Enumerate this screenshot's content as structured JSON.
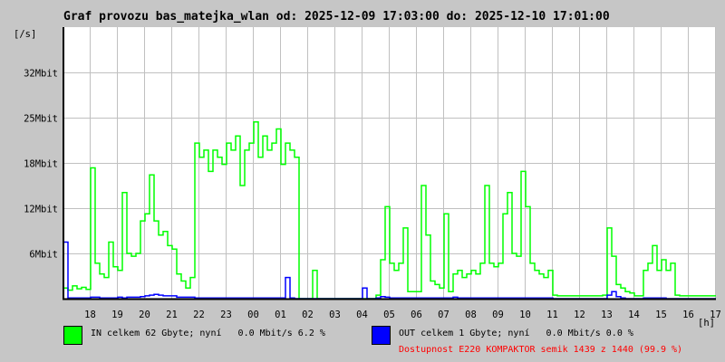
{
  "chart_data": {
    "type": "line",
    "title": "Graf provozu bas_matejka_wlan od: 2025-12-09 17:03:00 do: 2025-12-10 17:01:00",
    "ylabel": "[/s]",
    "xlabel": "[h]",
    "start_time": "2025-12-09 17:03:00",
    "sample_interval_minutes": 10,
    "total_minutes": 1440,
    "ylim_mbit": [
      0,
      38.4
    ],
    "y_ticks": [
      {
        "value": 6.4,
        "label": "6Mbit"
      },
      {
        "value": 12.8,
        "label": "12Mbit"
      },
      {
        "value": 19.2,
        "label": "18Mbit"
      },
      {
        "value": 25.6,
        "label": "25Mbit"
      },
      {
        "value": 32.0,
        "label": "32Mbit"
      }
    ],
    "x_ticks": [
      {
        "minute": 57,
        "label": "18"
      },
      {
        "minute": 117,
        "label": "19"
      },
      {
        "minute": 177,
        "label": "20"
      },
      {
        "minute": 237,
        "label": "21"
      },
      {
        "minute": 297,
        "label": "22"
      },
      {
        "minute": 357,
        "label": "23"
      },
      {
        "minute": 417,
        "label": "00"
      },
      {
        "minute": 477,
        "label": "01"
      },
      {
        "minute": 537,
        "label": "02"
      },
      {
        "minute": 597,
        "label": "03"
      },
      {
        "minute": 657,
        "label": "04"
      },
      {
        "minute": 717,
        "label": "05"
      },
      {
        "minute": 777,
        "label": "06"
      },
      {
        "minute": 837,
        "label": "07"
      },
      {
        "minute": 897,
        "label": "08"
      },
      {
        "minute": 957,
        "label": "09"
      },
      {
        "minute": 1017,
        "label": "10"
      },
      {
        "minute": 1077,
        "label": "11"
      },
      {
        "minute": 1137,
        "label": "12"
      },
      {
        "minute": 1197,
        "label": "13"
      },
      {
        "minute": 1257,
        "label": "14"
      },
      {
        "minute": 1317,
        "label": "15"
      },
      {
        "minute": 1377,
        "label": "16"
      },
      {
        "minute": 1437,
        "label": "17"
      }
    ],
    "grid": true,
    "series": [
      {
        "name": "IN",
        "color": "#00ff00",
        "unit": "Mbit/s",
        "values": [
          1.5,
          1.2,
          1.8,
          1.4,
          1.6,
          1.3,
          18.5,
          5,
          3.5,
          3,
          8,
          4.5,
          4,
          15,
          6.4,
          6,
          6.4,
          11,
          12,
          17.5,
          11,
          9,
          9.5,
          7.5,
          7,
          3.5,
          2.5,
          1.5,
          3,
          22,
          20,
          21,
          18,
          21,
          20,
          19,
          22,
          21,
          23,
          16,
          21,
          22,
          25,
          20,
          23,
          21,
          22,
          24,
          19,
          22,
          21,
          20,
          0,
          0,
          0,
          4,
          0,
          0,
          0,
          0,
          0,
          0,
          0,
          0,
          0,
          0,
          0,
          0,
          0,
          0.5,
          5.5,
          13,
          5,
          4,
          5,
          10,
          1,
          1,
          1,
          16,
          9,
          2.5,
          2,
          1.5,
          12,
          1,
          3.5,
          4,
          3,
          3.5,
          4,
          3.5,
          5,
          16,
          5,
          4.5,
          5,
          12,
          15,
          6.4,
          6,
          18,
          13,
          5,
          4,
          3.5,
          3,
          4,
          0.5,
          0.4,
          0.4,
          0.4,
          0.4,
          0.4,
          0.4,
          0.4,
          0.4,
          0.4,
          0.4,
          0.5,
          10,
          6,
          2,
          1.5,
          1,
          0.8,
          0.4,
          0.4,
          4,
          5,
          7.5,
          4,
          5.5,
          4,
          5,
          0.5,
          0.4,
          0.4,
          0.4,
          0.4,
          0.4,
          0.4,
          0.4,
          0.4,
          0.4
        ]
      },
      {
        "name": "OUT",
        "color": "#0000ff",
        "unit": "Mbit/s",
        "values": [
          8,
          0.1,
          0.1,
          0.1,
          0.1,
          0.1,
          0.2,
          0.2,
          0.1,
          0.1,
          0.1,
          0.1,
          0.2,
          0.1,
          0.2,
          0.2,
          0.2,
          0.3,
          0.4,
          0.5,
          0.6,
          0.5,
          0.4,
          0.4,
          0.4,
          0.2,
          0.2,
          0.2,
          0.2,
          0.1,
          0.1,
          0.1,
          0.1,
          0.1,
          0.1,
          0.1,
          0.1,
          0.1,
          0.1,
          0.1,
          0.1,
          0.1,
          0.1,
          0.1,
          0.1,
          0.1,
          0.1,
          0.1,
          0.1,
          3,
          0.1,
          0,
          0,
          0,
          0,
          0,
          0,
          0,
          0,
          0,
          0,
          0,
          0,
          0,
          0,
          0,
          1.5,
          0,
          0,
          0.1,
          0.3,
          0.2,
          0.1,
          0.1,
          0.1,
          0.1,
          0.1,
          0.1,
          0.1,
          0.1,
          0.1,
          0.1,
          0.1,
          0.1,
          0.1,
          0.1,
          0.2,
          0.1,
          0.1,
          0.1,
          0.1,
          0.1,
          0.1,
          0.1,
          0.1,
          0.1,
          0.1,
          0.1,
          0.1,
          0.1,
          0.1,
          0.1,
          0.1,
          0.1,
          0.1,
          0.1,
          0.1,
          0.1,
          0,
          0,
          0,
          0,
          0,
          0,
          0,
          0,
          0,
          0,
          0,
          0,
          0.5,
          1,
          0.3,
          0.1,
          0,
          0,
          0,
          0,
          0.1,
          0.1,
          0.1,
          0.1,
          0.1,
          0,
          0,
          0,
          0,
          0,
          0,
          0,
          0,
          0,
          0,
          0,
          0
        ]
      }
    ]
  },
  "legend": {
    "in_text": "IN celkem 62 Gbyte; nyní   0.0 Mbit/s 6.2 %",
    "out_text": "OUT celkem 1 Gbyte; nyní   0.0 Mbit/s 0.0 %",
    "availability_text": "Dostupnost E220 KOMPAKTOR semik 1439 z 1440 (99.9 %)",
    "availability_color": "#ff0000"
  }
}
